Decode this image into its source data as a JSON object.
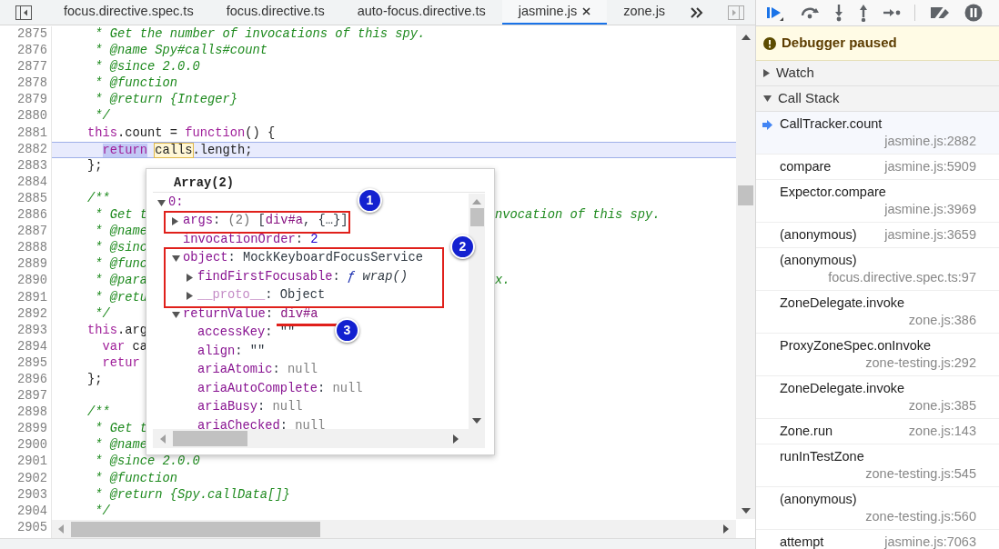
{
  "tabs": [
    {
      "label": "focus.directive.spec.ts",
      "selected": false,
      "closable": false
    },
    {
      "label": "focus.directive.ts",
      "selected": false,
      "closable": false
    },
    {
      "label": "auto-focus.directive.ts",
      "selected": false,
      "closable": false
    },
    {
      "label": "jasmine.js",
      "selected": true,
      "closable": true
    },
    {
      "label": "zone.js",
      "selected": false,
      "closable": false
    }
  ],
  "editor": {
    "lines": [
      {
        "number": "2875",
        "current": false,
        "tokens": [
          {
            "text": "     * Get the number of invocations of this spy.",
            "kind": "comment"
          }
        ]
      },
      {
        "number": "2876",
        "current": false,
        "tokens": [
          {
            "text": "     * @name Spy#calls#count",
            "kind": "comment"
          }
        ]
      },
      {
        "number": "2877",
        "current": false,
        "tokens": [
          {
            "text": "     * @since 2.0.0",
            "kind": "comment"
          }
        ]
      },
      {
        "number": "2878",
        "current": false,
        "tokens": [
          {
            "text": "     * @function",
            "kind": "comment"
          }
        ]
      },
      {
        "number": "2879",
        "current": false,
        "tokens": [
          {
            "text": "     * @return {Integer}",
            "kind": "comment"
          }
        ]
      },
      {
        "number": "2880",
        "current": false,
        "tokens": [
          {
            "text": "     */",
            "kind": "comment"
          }
        ]
      },
      {
        "number": "2881",
        "current": false,
        "tokens": [
          {
            "text": "    this",
            "kind": "keyword"
          },
          {
            "text": ".count = ",
            "kind": "plain"
          },
          {
            "text": "function",
            "kind": "keyword"
          },
          {
            "text": "() {",
            "kind": "plain"
          }
        ]
      },
      {
        "number": "2882",
        "current": true,
        "tokens": [
          {
            "text": "      return",
            "kind": "selection"
          },
          {
            "text": " calls",
            "kind": "hovered"
          },
          {
            "text": ".length;",
            "kind": "plain"
          }
        ]
      },
      {
        "number": "2883",
        "current": false,
        "tokens": [
          {
            "text": "    };",
            "kind": "plain"
          }
        ]
      },
      {
        "number": "2884",
        "current": false
      },
      {
        "number": "2885",
        "current": false,
        "tokens": [
          {
            "text": "    /**",
            "kind": "comment"
          }
        ]
      },
      {
        "number": "2886",
        "current": false,
        "tokens": [
          {
            "text": "     * Get t",
            "kind": "comment"
          }
        ],
        "tail": {
          "text": "nvocation of this spy.",
          "kind": "comment"
        }
      },
      {
        "number": "2887",
        "current": false,
        "tokens": [
          {
            "text": "     * @name",
            "kind": "comment"
          }
        ]
      },
      {
        "number": "2888",
        "current": false,
        "tokens": [
          {
            "text": "     * @sinc",
            "kind": "comment"
          }
        ]
      },
      {
        "number": "2889",
        "current": false,
        "tokens": [
          {
            "text": "     * @func",
            "kind": "comment"
          }
        ]
      },
      {
        "number": "2890",
        "current": false,
        "tokens": [
          {
            "text": "     * @para",
            "kind": "comment"
          }
        ],
        "tail": {
          "text": "x.",
          "kind": "comment"
        }
      },
      {
        "number": "2891",
        "current": false,
        "tokens": [
          {
            "text": "     * @retu",
            "kind": "comment"
          }
        ]
      },
      {
        "number": "2892",
        "current": false,
        "tokens": [
          {
            "text": "     */",
            "kind": "comment"
          }
        ]
      },
      {
        "number": "2893",
        "current": false,
        "tokens": [
          {
            "text": "    this",
            "kind": "keyword"
          },
          {
            "text": ".arg",
            "kind": "plain"
          }
        ]
      },
      {
        "number": "2894",
        "current": false,
        "tokens": [
          {
            "text": "      var",
            "kind": "keyword"
          },
          {
            "text": " ca",
            "kind": "plain"
          }
        ]
      },
      {
        "number": "2895",
        "current": false,
        "tokens": [
          {
            "text": "      retur",
            "kind": "keyword"
          }
        ]
      },
      {
        "number": "2896",
        "current": false,
        "tokens": [
          {
            "text": "    };",
            "kind": "plain"
          }
        ]
      },
      {
        "number": "2897",
        "current": false
      },
      {
        "number": "2898",
        "current": false,
        "tokens": [
          {
            "text": "    /**",
            "kind": "comment"
          }
        ]
      },
      {
        "number": "2899",
        "current": false,
        "tokens": [
          {
            "text": "     * Get t",
            "kind": "comment"
          }
        ]
      },
      {
        "number": "2900",
        "current": false,
        "tokens": [
          {
            "text": "     * @name",
            "kind": "comment"
          }
        ]
      },
      {
        "number": "2901",
        "current": false,
        "tokens": [
          {
            "text": "     * @since 2.0.0",
            "kind": "comment"
          }
        ]
      },
      {
        "number": "2902",
        "current": false,
        "tokens": [
          {
            "text": "     * @function",
            "kind": "comment"
          }
        ]
      },
      {
        "number": "2903",
        "current": false,
        "tokens": [
          {
            "text": "     * @return {Spy.callData[]}",
            "kind": "comment"
          }
        ]
      },
      {
        "number": "2904",
        "current": false,
        "tokens": [
          {
            "text": "     */",
            "kind": "comment"
          }
        ]
      },
      {
        "number": "2905"
      }
    ]
  },
  "popup": {
    "title": "Array(2)",
    "tree": [
      {
        "key": "0:",
        "expanded": true,
        "dimmed": false,
        "children": [
          {
            "key": "args",
            "expanded": false,
            "dimmed": false,
            "value": [
              {
                "text": ": ",
                "kind": "plain"
              },
              {
                "text": "(2)",
                "kind": "count"
              },
              {
                "text": " [",
                "kind": "plain"
              },
              {
                "text": "div#a",
                "kind": "node"
              },
              {
                "text": ", {…}]",
                "kind": "plain"
              }
            ]
          },
          {
            "key": "invocationOrder",
            "dimmed": false,
            "value": [
              {
                "text": ": ",
                "kind": "plain"
              },
              {
                "text": "2",
                "kind": "number"
              }
            ]
          },
          {
            "key": "object",
            "expanded": true,
            "dimmed": false,
            "value": [
              {
                "text": ": MockKeyboardFocusService",
                "kind": "plain"
              }
            ],
            "children": [
              {
                "key": "findFirstFocusable",
                "expanded": false,
                "dimmed": false,
                "value": [
                  {
                    "text": ": ",
                    "kind": "plain"
                  },
                  {
                    "text": "ƒ",
                    "kind": "function-sign"
                  },
                  {
                    "text": " wrap()",
                    "kind": "function"
                  }
                ]
              },
              {
                "key": "__proto__",
                "expanded": false,
                "dimmed": true,
                "value": [
                  {
                    "text": ": Object",
                    "kind": "plain"
                  }
                ]
              }
            ]
          },
          {
            "key": "returnValue",
            "expanded": true,
            "dimmed": false,
            "value": [
              {
                "text": ": ",
                "kind": "plain"
              },
              {
                "text": "div#a",
                "kind": "node"
              }
            ],
            "children": [
              {
                "key": "accessKey",
                "dimmed": false,
                "value": [
                  {
                    "text": ": \"\"",
                    "kind": "plain"
                  }
                ]
              },
              {
                "key": "align",
                "dimmed": false,
                "value": [
                  {
                    "text": ": \"\"",
                    "kind": "plain"
                  }
                ]
              },
              {
                "key": "ariaAtomic",
                "dimmed": false,
                "value": [
                  {
                    "text": ": ",
                    "kind": "plain"
                  },
                  {
                    "text": "null",
                    "kind": "null"
                  }
                ]
              },
              {
                "key": "ariaAutoComplete",
                "dimmed": false,
                "value": [
                  {
                    "text": ": ",
                    "kind": "plain"
                  },
                  {
                    "text": "null",
                    "kind": "null"
                  }
                ]
              },
              {
                "key": "ariaBusy",
                "dimmed": false,
                "value": [
                  {
                    "text": ": ",
                    "kind": "plain"
                  },
                  {
                    "text": "null",
                    "kind": "null"
                  }
                ]
              },
              {
                "key": "ariaChecked",
                "dimmed": false,
                "value": [
                  {
                    "text": ": ",
                    "kind": "plain"
                  },
                  {
                    "text": "null",
                    "kind": "null"
                  }
                ]
              }
            ]
          }
        ]
      }
    ],
    "annotations": [
      {
        "number": "1",
        "kind": "box"
      },
      {
        "number": "2",
        "kind": "box"
      },
      {
        "number": "3",
        "kind": "underline"
      }
    ]
  },
  "debugger": {
    "banner": "Debugger paused",
    "sections": [
      {
        "label": "Watch",
        "expanded": false
      },
      {
        "label": "Call Stack",
        "expanded": true
      }
    ],
    "frames": [
      {
        "name": "CallTracker.count",
        "location": "jasmine.js:2882",
        "selected": true
      },
      {
        "name": "compare",
        "location": "jasmine.js:5909",
        "selected": false
      },
      {
        "name": "Expector.compare",
        "location": "jasmine.js:3969",
        "selected": false
      },
      {
        "name": "(anonymous)",
        "location": "jasmine.js:3659",
        "selected": false
      },
      {
        "name": "(anonymous)",
        "location": "focus.directive.spec.ts:97",
        "selected": false
      },
      {
        "name": "ZoneDelegate.invoke",
        "location": "zone.js:386",
        "selected": false
      },
      {
        "name": "ProxyZoneSpec.onInvoke",
        "location": "zone-testing.js:292",
        "selected": false
      },
      {
        "name": "ZoneDelegate.invoke",
        "location": "zone.js:385",
        "selected": false
      },
      {
        "name": "Zone.run",
        "location": "zone.js:143",
        "selected": false
      },
      {
        "name": "runInTestZone",
        "location": "zone-testing.js:545",
        "selected": false
      },
      {
        "name": "(anonymous)",
        "location": "zone-testing.js:560",
        "selected": false
      },
      {
        "name": "attempt",
        "location": "jasmine.js:7063",
        "selected": false
      }
    ]
  }
}
